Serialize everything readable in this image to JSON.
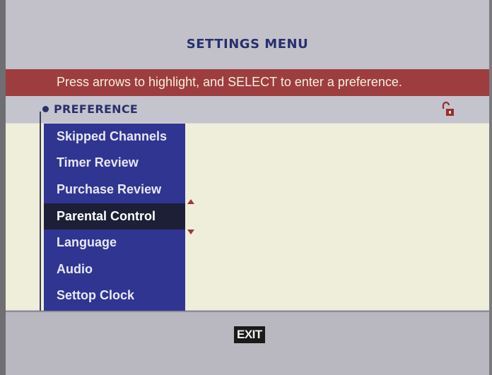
{
  "header": {
    "title": "SETTINGS MENU",
    "instruction": "Press arrows to highlight, and SELECT to enter a preference."
  },
  "preference_bar": {
    "label": "PREFERENCE",
    "lock_icon": "unlocked-padlock-icon"
  },
  "menu": {
    "items": [
      {
        "label": "Skipped Channels",
        "selected": false
      },
      {
        "label": "Timer Review",
        "selected": false
      },
      {
        "label": "Purchase Review",
        "selected": false
      },
      {
        "label": "Parental Control",
        "selected": true
      },
      {
        "label": "Language",
        "selected": false
      },
      {
        "label": "Audio",
        "selected": false
      },
      {
        "label": "Settop Clock",
        "selected": false
      }
    ],
    "scroll_up_icon": "triangle-up-icon",
    "scroll_down_icon": "triangle-down-icon"
  },
  "footer": {
    "exit_label": "EXIT"
  },
  "colors": {
    "menu_background": "#2f3591",
    "menu_selected": "#1c1f35",
    "instruction_bar": "#9e3d3f",
    "content_background": "#efeedb",
    "title_text": "#27306e"
  }
}
